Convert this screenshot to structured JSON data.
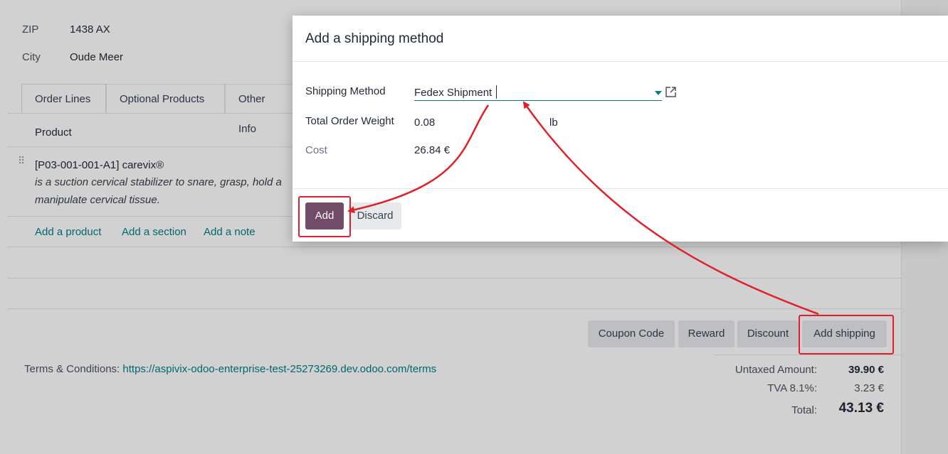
{
  "address": {
    "zip_label": "ZIP",
    "zip_value": "1438 AX",
    "city_label": "City",
    "city_value": "Oude Meer"
  },
  "tabs": [
    {
      "label": "Order Lines"
    },
    {
      "label": "Optional Products"
    },
    {
      "label": "Other Info"
    }
  ],
  "order_lines": {
    "column_product": "Product",
    "line": {
      "name": "[P03-001-001-A1] carevix®",
      "description_1": "is a suction cervical stabilizer to snare, grasp, hold a",
      "description_2": "manipulate cervical tissue."
    },
    "add_product": "Add a product",
    "add_section": "Add a section",
    "add_note": "Add a note"
  },
  "actions": {
    "coupon": "Coupon Code",
    "reward": "Reward",
    "discount": "Discount",
    "add_shipping": "Add shipping"
  },
  "terms": {
    "label": "Terms & Conditions: ",
    "url": "https://aspivix-odoo-enterprise-test-25273269.dev.odoo.com/terms"
  },
  "totals": {
    "untaxed_label": "Untaxed Amount:",
    "untaxed_value": "39.90 €",
    "tva_label": "TVA 8.1%:",
    "tva_value": "3.23 €",
    "total_label": "Total:",
    "total_value": "43.13 €"
  },
  "modal": {
    "title": "Add a shipping method",
    "shipping_method_label": "Shipping Method",
    "shipping_method_value": "Fedex Shipment",
    "weight_label": "Total Order Weight",
    "weight_value": "0.08",
    "weight_unit": "lb",
    "cost_label": "Cost",
    "cost_value": "26.84 €",
    "add_button": "Add",
    "discard_button": "Discard"
  },
  "colors": {
    "primary": "#714b67",
    "link": "#017e84",
    "annotation": "#e0202a"
  }
}
